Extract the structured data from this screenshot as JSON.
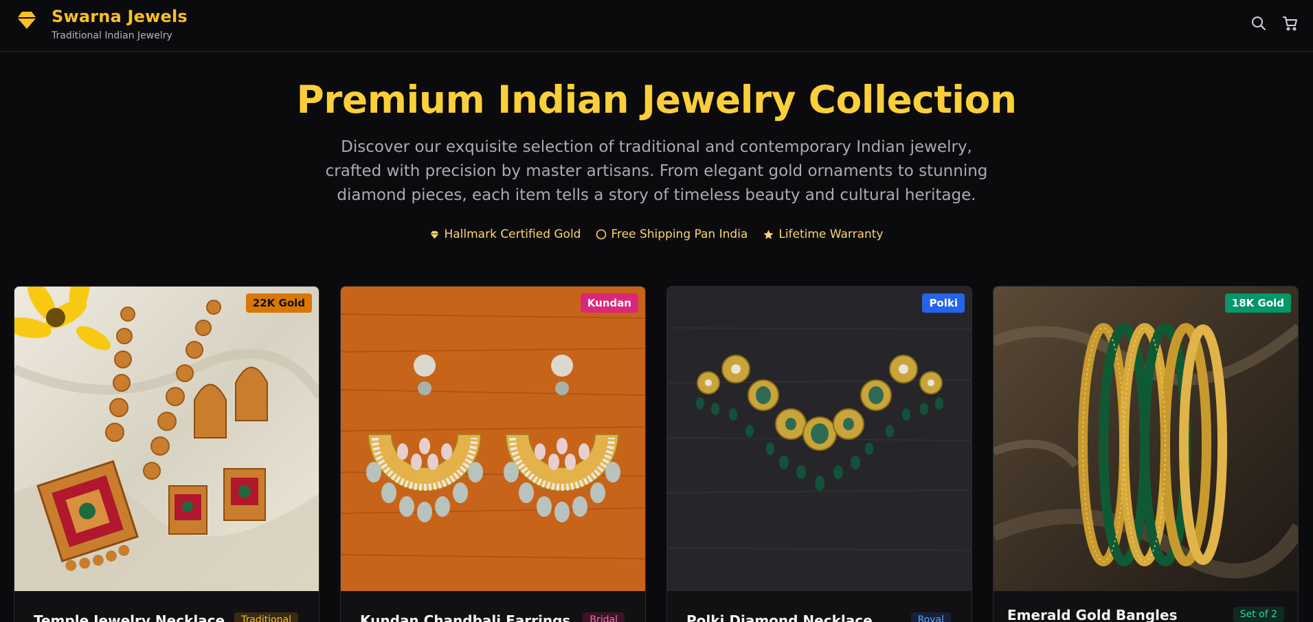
{
  "brand": {
    "name": "Swarna Jewels",
    "tagline": "Traditional Indian Jewelry"
  },
  "header": {
    "icons": [
      "search-icon",
      "cart-icon"
    ]
  },
  "hero": {
    "title": "Premium Indian Jewelry Collection",
    "description": "Discover our exquisite selection of traditional and contemporary Indian jewelry, crafted with precision by master artisans. From elegant gold ornaments to stunning diamond pieces, each item tells a story of timeless beauty and cultural heritage.",
    "features": [
      {
        "label": "Hallmark Certified Gold",
        "icon": "gem-icon"
      },
      {
        "label": "Free Shipping Pan India",
        "icon": "circle-icon"
      },
      {
        "label": "Lifetime Warranty",
        "icon": "star-icon"
      }
    ]
  },
  "colors": {
    "accent": "#fbbf24",
    "background": "#0b0b0d"
  },
  "products": [
    {
      "name": "Temple Jewelry Necklace",
      "badge": "22K Gold",
      "badge_color": "#d97706",
      "tag": "Traditional",
      "image": "temple-necklace-set-image"
    },
    {
      "name": "Kundan Chandbali Earrings",
      "badge": "Kundan",
      "badge_color": "#db2777",
      "tag": "Bridal",
      "image": "kundan-earrings-image"
    },
    {
      "name": "Polki Diamond Necklace",
      "badge": "Polki",
      "badge_color": "#2563eb",
      "tag": "Royal",
      "image": "polki-necklace-image"
    },
    {
      "name": "Emerald Gold Bangles",
      "badge": "18K Gold",
      "badge_color": "#059669",
      "tag": "Set of 2",
      "image": "emerald-bangles-image"
    }
  ]
}
